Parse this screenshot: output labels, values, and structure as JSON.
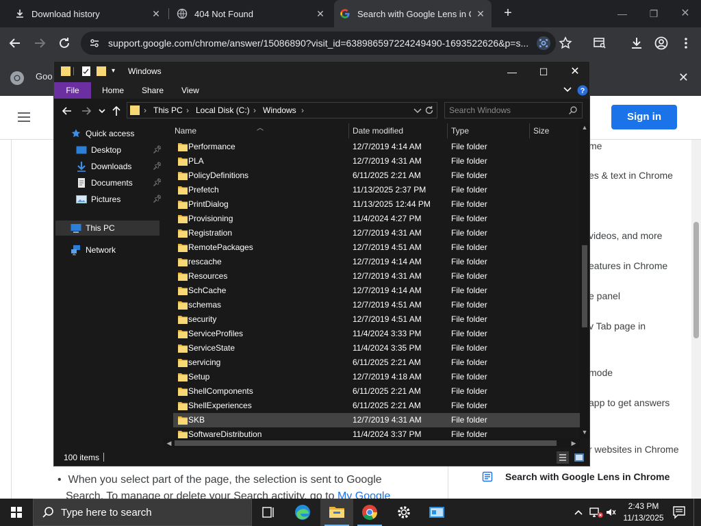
{
  "browser": {
    "tabs": [
      {
        "title": "Download history",
        "icon": "download-icon",
        "active": false
      },
      {
        "title": "404 Not Found",
        "icon": "globe-icon",
        "active": false
      },
      {
        "title": "Search with Google Lens in Chrome",
        "icon": "google-icon",
        "active": true
      }
    ],
    "url": "support.google.com/chrome/answer/15086890?visit_id=638986597224249490-1693522626&p=s...",
    "infobar_text": "Goo"
  },
  "webpage": {
    "signin_label": "Sign in",
    "toc": [
      "me",
      "es & text in Chrome",
      "videos, and more",
      "eatures in Chrome",
      "e panel",
      "v Tab page in",
      "mode",
      "app to get answers",
      "r websites in Chrome"
    ],
    "toc_active": "Search with Google Lens in Chrome",
    "body_line1": "When you select part of the page, the selection is sent to Google",
    "body_line2_prefix": "Search. To manage or delete your Search activity, go to ",
    "body_line2_link": "My Google"
  },
  "explorer": {
    "title": "Windows",
    "ribbon": {
      "file": "File",
      "home": "Home",
      "share": "Share",
      "view": "View"
    },
    "breadcrumb": [
      "This PC",
      "Local Disk (C:)",
      "Windows"
    ],
    "search_placeholder": "Search Windows",
    "nav": {
      "quick_access": "Quick access",
      "desktop": "Desktop",
      "downloads": "Downloads",
      "documents": "Documents",
      "pictures": "Pictures",
      "this_pc": "This PC",
      "network": "Network"
    },
    "columns": {
      "name": "Name",
      "date": "Date modified",
      "type": "Type",
      "size": "Size"
    },
    "files": [
      {
        "name": "Performance",
        "date": "12/7/2019 4:14 AM",
        "type": "File folder"
      },
      {
        "name": "PLA",
        "date": "12/7/2019 4:31 AM",
        "type": "File folder"
      },
      {
        "name": "PolicyDefinitions",
        "date": "6/11/2025 2:21 AM",
        "type": "File folder"
      },
      {
        "name": "Prefetch",
        "date": "11/13/2025 2:37 PM",
        "type": "File folder"
      },
      {
        "name": "PrintDialog",
        "date": "11/13/2025 12:44 PM",
        "type": "File folder"
      },
      {
        "name": "Provisioning",
        "date": "11/4/2024 4:27 PM",
        "type": "File folder"
      },
      {
        "name": "Registration",
        "date": "12/7/2019 4:31 AM",
        "type": "File folder"
      },
      {
        "name": "RemotePackages",
        "date": "12/7/2019 4:51 AM",
        "type": "File folder"
      },
      {
        "name": "rescache",
        "date": "12/7/2019 4:14 AM",
        "type": "File folder"
      },
      {
        "name": "Resources",
        "date": "12/7/2019 4:31 AM",
        "type": "File folder"
      },
      {
        "name": "SchCache",
        "date": "12/7/2019 4:14 AM",
        "type": "File folder"
      },
      {
        "name": "schemas",
        "date": "12/7/2019 4:51 AM",
        "type": "File folder"
      },
      {
        "name": "security",
        "date": "12/7/2019 4:51 AM",
        "type": "File folder"
      },
      {
        "name": "ServiceProfiles",
        "date": "11/4/2024 3:33 PM",
        "type": "File folder"
      },
      {
        "name": "ServiceState",
        "date": "11/4/2024 3:35 PM",
        "type": "File folder"
      },
      {
        "name": "servicing",
        "date": "6/11/2025 2:21 AM",
        "type": "File folder"
      },
      {
        "name": "Setup",
        "date": "12/7/2019 4:18 AM",
        "type": "File folder"
      },
      {
        "name": "ShellComponents",
        "date": "6/11/2025 2:21 AM",
        "type": "File folder"
      },
      {
        "name": "ShellExperiences",
        "date": "6/11/2025 2:21 AM",
        "type": "File folder"
      },
      {
        "name": "SKB",
        "date": "12/7/2019 4:31 AM",
        "type": "File folder",
        "selected": true
      },
      {
        "name": "SoftwareDistribution",
        "date": "11/4/2024 3:37 PM",
        "type": "File folder"
      }
    ],
    "status": "100 items"
  },
  "taskbar": {
    "search_placeholder": "Type here to search",
    "time": "2:43 PM",
    "date": "11/13/2025"
  },
  "colors": {
    "chrome_dark": "#202124",
    "chrome_toolbar": "#35363a",
    "explorer_bg": "#191919",
    "file_tab": "#6b2fa1",
    "folder_yellow": "#f8d775",
    "signin_blue": "#1a73e8",
    "taskbar": "#1f1f1f"
  }
}
